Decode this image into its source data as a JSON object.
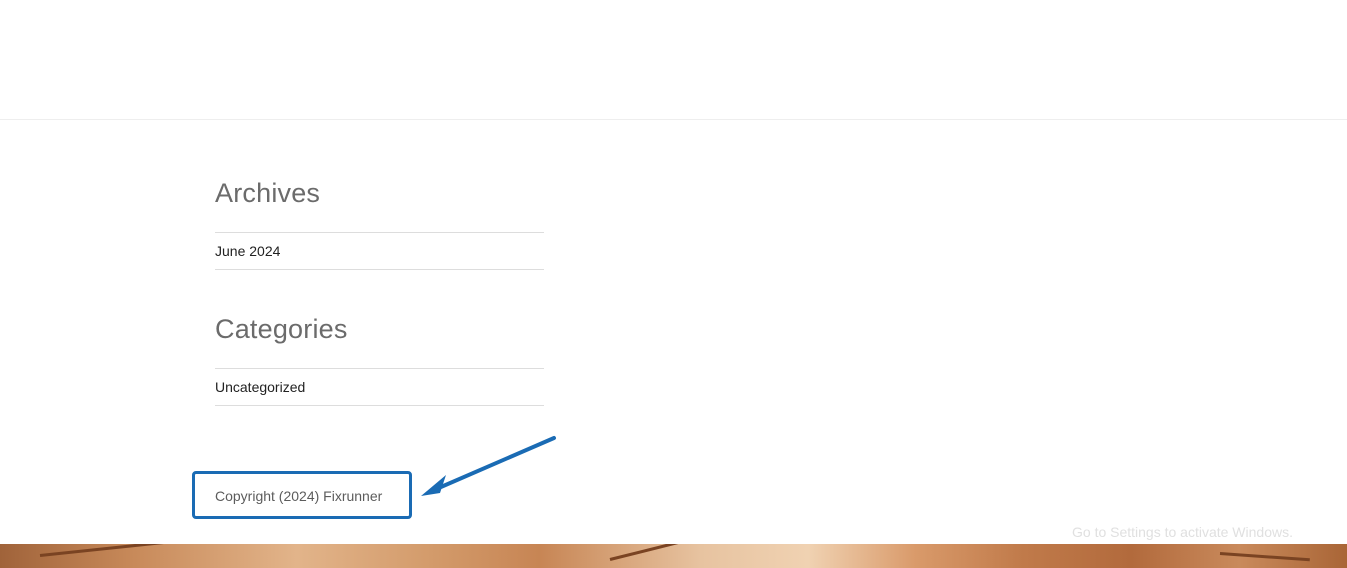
{
  "sidebar": {
    "archives": {
      "title": "Archives",
      "items": [
        {
          "label": "June 2024"
        }
      ]
    },
    "categories": {
      "title": "Categories",
      "items": [
        {
          "label": "Uncategorized"
        }
      ]
    }
  },
  "footer": {
    "copyright": "Copyright (2024) Fixrunner"
  },
  "overlay": {
    "watermark": "Go to Settings to activate Windows."
  },
  "colors": {
    "highlight": "#1a6bb4",
    "heading": "#6b6b6b",
    "link": "#222222",
    "divider": "#dddddd"
  }
}
